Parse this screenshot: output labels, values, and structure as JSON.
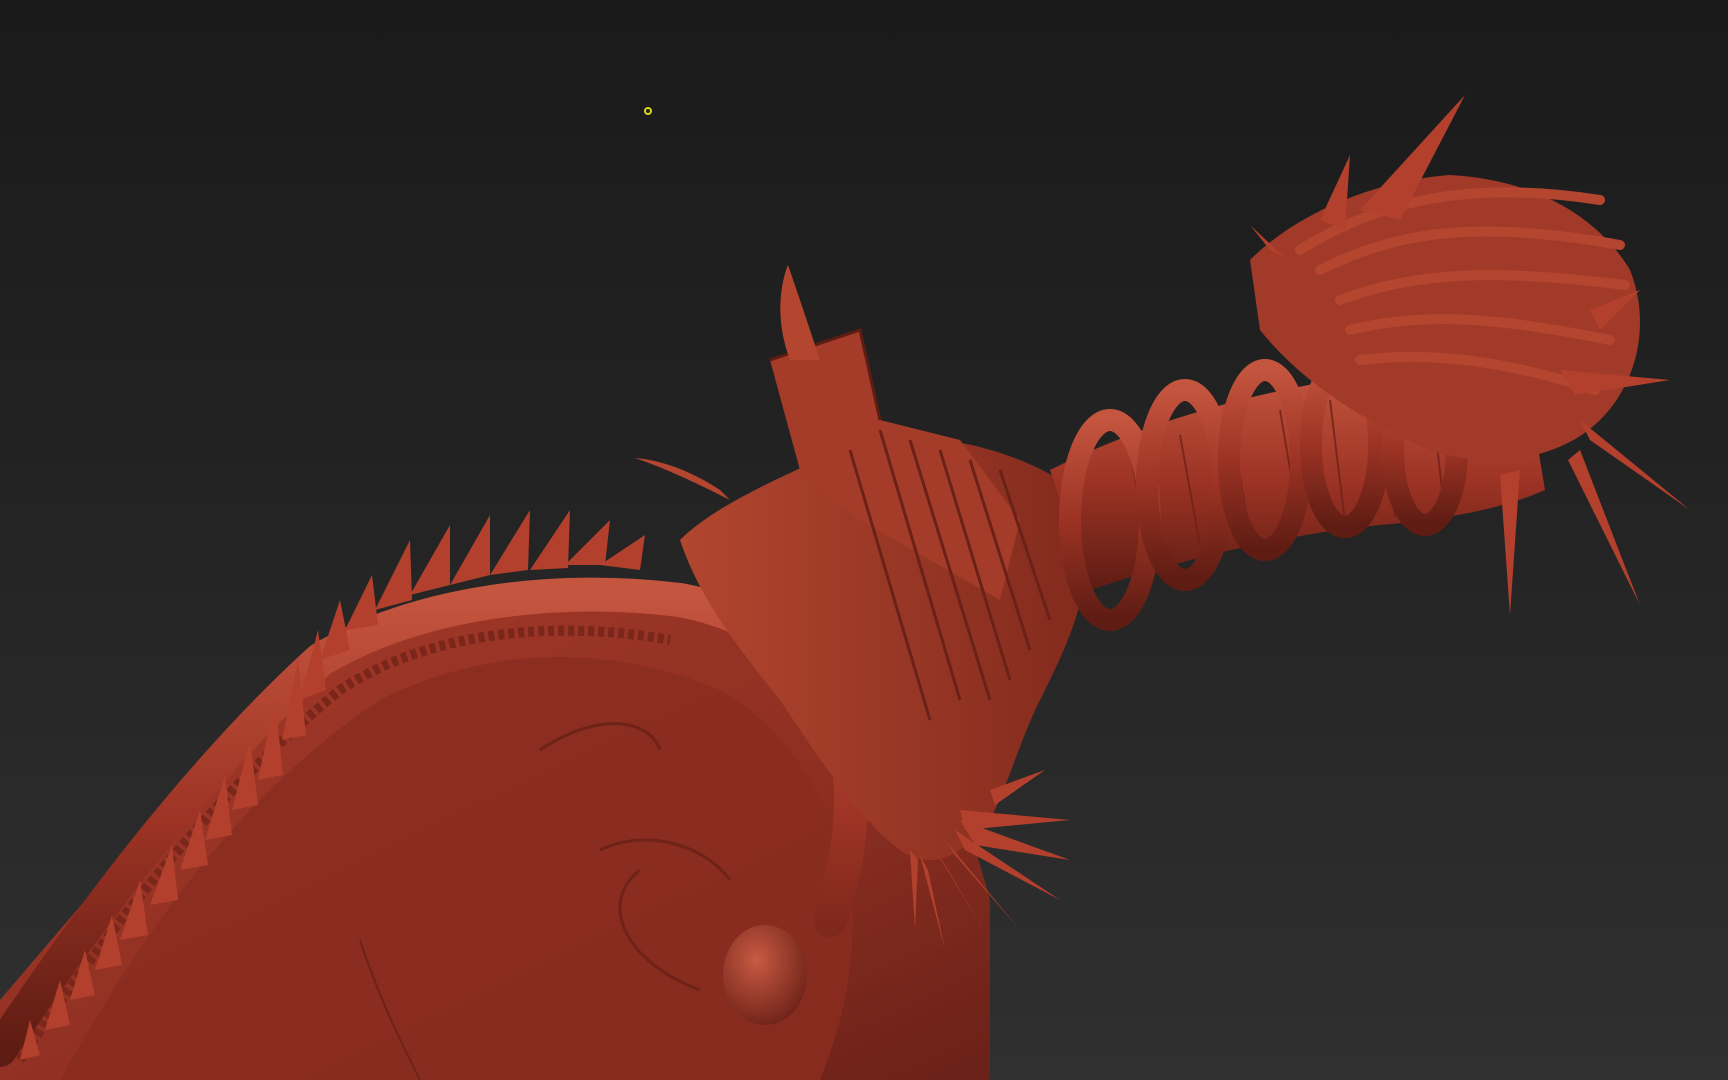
{
  "viewport": {
    "background_top": "#1a1a1a",
    "background_bottom": "#303030"
  },
  "model": {
    "material_color": "#9c3324",
    "highlight_color": "#c4553f",
    "shadow_color": "#5e1c13"
  },
  "cursor": {
    "icon": "brush-cursor-icon",
    "color": "#d6d61c"
  }
}
